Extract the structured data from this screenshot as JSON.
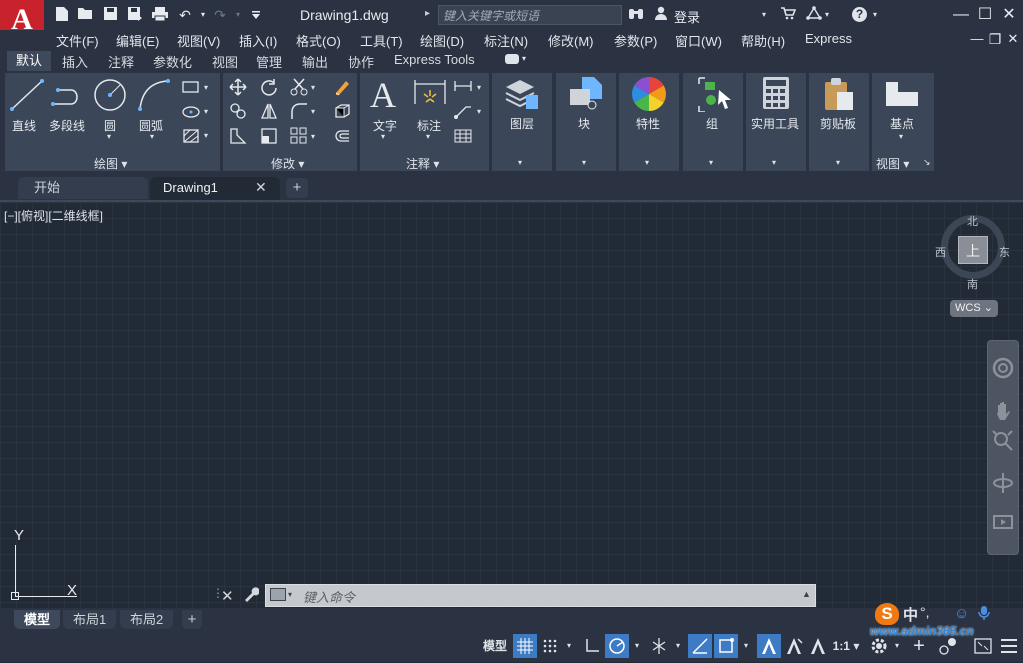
{
  "app": {
    "logo_letter": "A",
    "logo_arrow": "▾",
    "brand_color": "#c8232c"
  },
  "quick_access": {
    "icons": [
      "new-icon",
      "open-icon",
      "save-icon",
      "save-as-icon",
      "print-icon",
      "undo-icon",
      "redo-icon",
      "customize-icon"
    ],
    "undo_glyph": "↶",
    "redo_glyph": "↷",
    "drop_glyph": "▾"
  },
  "title": "Drawing1.dwg",
  "search": {
    "placeholder": "键入关键字或短语",
    "arrow": "▸"
  },
  "login": "登录",
  "window_controls": {
    "minimize": "—",
    "maximize": "☐",
    "close": "✕",
    "help": "?"
  },
  "doc_controls": {
    "minimize": "—",
    "restore": "❐",
    "close": "✕"
  },
  "menu": [
    "文件(F)",
    "编辑(E)",
    "视图(V)",
    "插入(I)",
    "格式(O)",
    "工具(T)",
    "绘图(D)",
    "标注(N)",
    "修改(M)",
    "参数(P)",
    "窗口(W)",
    "帮助(H)",
    "Express"
  ],
  "ribbon_tabs": [
    "默认",
    "插入",
    "注释",
    "参数化",
    "视图",
    "管理",
    "输出",
    "协作",
    "Express Tools"
  ],
  "ribbon": {
    "draw": {
      "title": "绘图 ▾",
      "line": "直线",
      "polyline": "多段线",
      "circle": "圆",
      "arc": "圆弧"
    },
    "modify": {
      "title": "修改 ▾"
    },
    "annotation": {
      "title": "注释 ▾",
      "text": "文字",
      "dimension": "标注",
      "text_glyph": "A"
    },
    "layers": "图层",
    "block": "块",
    "properties": "特性",
    "group": "组",
    "utilities": "实用工具",
    "clipboard": "剪贴板",
    "view": {
      "basepoint": "基点",
      "title": "视图 ▾",
      "corner": "↘"
    }
  },
  "file_tabs": {
    "start": "开始",
    "drawing": "Drawing1",
    "close": "✕",
    "add": "+"
  },
  "viewport_label": "[−][俯视][二维线框]",
  "viewcube": {
    "top": "上",
    "north": "北",
    "south": "南",
    "east": "东",
    "west": "西",
    "wcs": "WCS ⌄"
  },
  "ucs": {
    "x": "X",
    "y": "Y"
  },
  "command": {
    "placeholder": "键入命令",
    "close": "✕",
    "up": "▲"
  },
  "layout_tabs": {
    "model": "模型",
    "layout1": "布局1",
    "layout2": "布局2",
    "add": "+"
  },
  "status": {
    "model": "模型",
    "scale": "1:1 ▾"
  },
  "watermark": {
    "s": "S",
    "zh": "中",
    "dots": "°,",
    "url": "www.admin365.cn"
  }
}
